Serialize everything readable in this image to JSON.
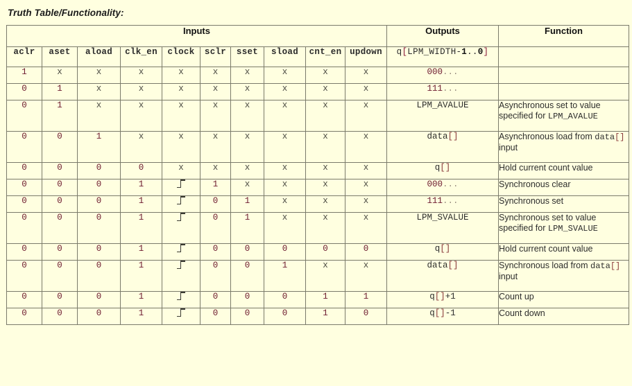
{
  "page": {
    "title": "Truth Table/Functionality:",
    "background_color": "#ffffe0",
    "border_color": "#7a7a6a"
  },
  "table": {
    "group_headers": [
      {
        "label": "Inputs",
        "span": 10
      },
      {
        "label": "Outputs",
        "span": 1
      },
      {
        "label": "Function",
        "span": 1
      }
    ],
    "input_columns": [
      "aclr",
      "aset",
      "aload",
      "clk_en",
      "clock",
      "sclr",
      "sset",
      "sload",
      "cnt_en",
      "updown"
    ],
    "output_column": "q[LPM_WIDTH-1..0]",
    "function_column": "",
    "rows": [
      {
        "inputs": [
          "1",
          "x",
          "x",
          "x",
          "x",
          "x",
          "x",
          "x",
          "x",
          "x"
        ],
        "output": "000...",
        "function": "",
        "tall": false
      },
      {
        "inputs": [
          "0",
          "1",
          "x",
          "x",
          "x",
          "x",
          "x",
          "x",
          "x",
          "x"
        ],
        "output": "111...",
        "function": "",
        "tall": false
      },
      {
        "inputs": [
          "0",
          "1",
          "x",
          "x",
          "x",
          "x",
          "x",
          "x",
          "x",
          "x"
        ],
        "output": "LPM_AVALUE",
        "function": "Asynchronous set to value specified for LPM_AVALUE",
        "function_plain": "Asynchronous set to value specified for ",
        "function_mono": "LPM_AVALUE",
        "tall": true
      },
      {
        "inputs": [
          "0",
          "0",
          "1",
          "x",
          "x",
          "x",
          "x",
          "x",
          "x",
          "x"
        ],
        "output": "data[]",
        "function": "Asynchronous load from data[] input",
        "function_plain": "Asynchronous load from ",
        "function_mono": "data[]",
        "function_tail": " input",
        "tall": true
      },
      {
        "inputs": [
          "0",
          "0",
          "0",
          "0",
          "x",
          "x",
          "x",
          "x",
          "x",
          "x"
        ],
        "output": "q[]",
        "function": "Hold current count value",
        "tall": false
      },
      {
        "inputs": [
          "0",
          "0",
          "0",
          "1",
          "clock",
          "1",
          "x",
          "x",
          "x",
          "x"
        ],
        "output": "000...",
        "function": "Synchronous clear",
        "tall": false
      },
      {
        "inputs": [
          "0",
          "0",
          "0",
          "1",
          "clock",
          "0",
          "1",
          "x",
          "x",
          "x"
        ],
        "output": "111...",
        "function": "Synchronous set",
        "tall": false
      },
      {
        "inputs": [
          "0",
          "0",
          "0",
          "1",
          "clock",
          "0",
          "1",
          "x",
          "x",
          "x"
        ],
        "output": "LPM_SVALUE",
        "function": "Synchronous set to value specified for LPM_SVALUE",
        "function_plain": "Synchronous set to value specified for ",
        "function_mono": "LPM_SVALUE",
        "tall": true
      },
      {
        "inputs": [
          "0",
          "0",
          "0",
          "1",
          "clock",
          "0",
          "0",
          "0",
          "0",
          "0"
        ],
        "output": "q[]",
        "function": "Hold current count value",
        "tall": false
      },
      {
        "inputs": [
          "0",
          "0",
          "0",
          "1",
          "clock",
          "0",
          "0",
          "1",
          "x",
          "x"
        ],
        "output": "data[]",
        "function": "Synchronous load from data[] input",
        "function_plain": "Synchronous load from ",
        "function_mono": "data[]",
        "function_tail": " input",
        "tall": true
      },
      {
        "inputs": [
          "0",
          "0",
          "0",
          "1",
          "clock",
          "0",
          "0",
          "0",
          "1",
          "1"
        ],
        "output": "q[]+1",
        "function": "Count up",
        "tall": false
      },
      {
        "inputs": [
          "0",
          "0",
          "0",
          "1",
          "clock",
          "0",
          "0",
          "0",
          "1",
          "0"
        ],
        "output": "q[]-1",
        "function": "Count down",
        "tall": false
      }
    ],
    "icons": {
      "clock_edge": "rising-edge-icon"
    }
  }
}
